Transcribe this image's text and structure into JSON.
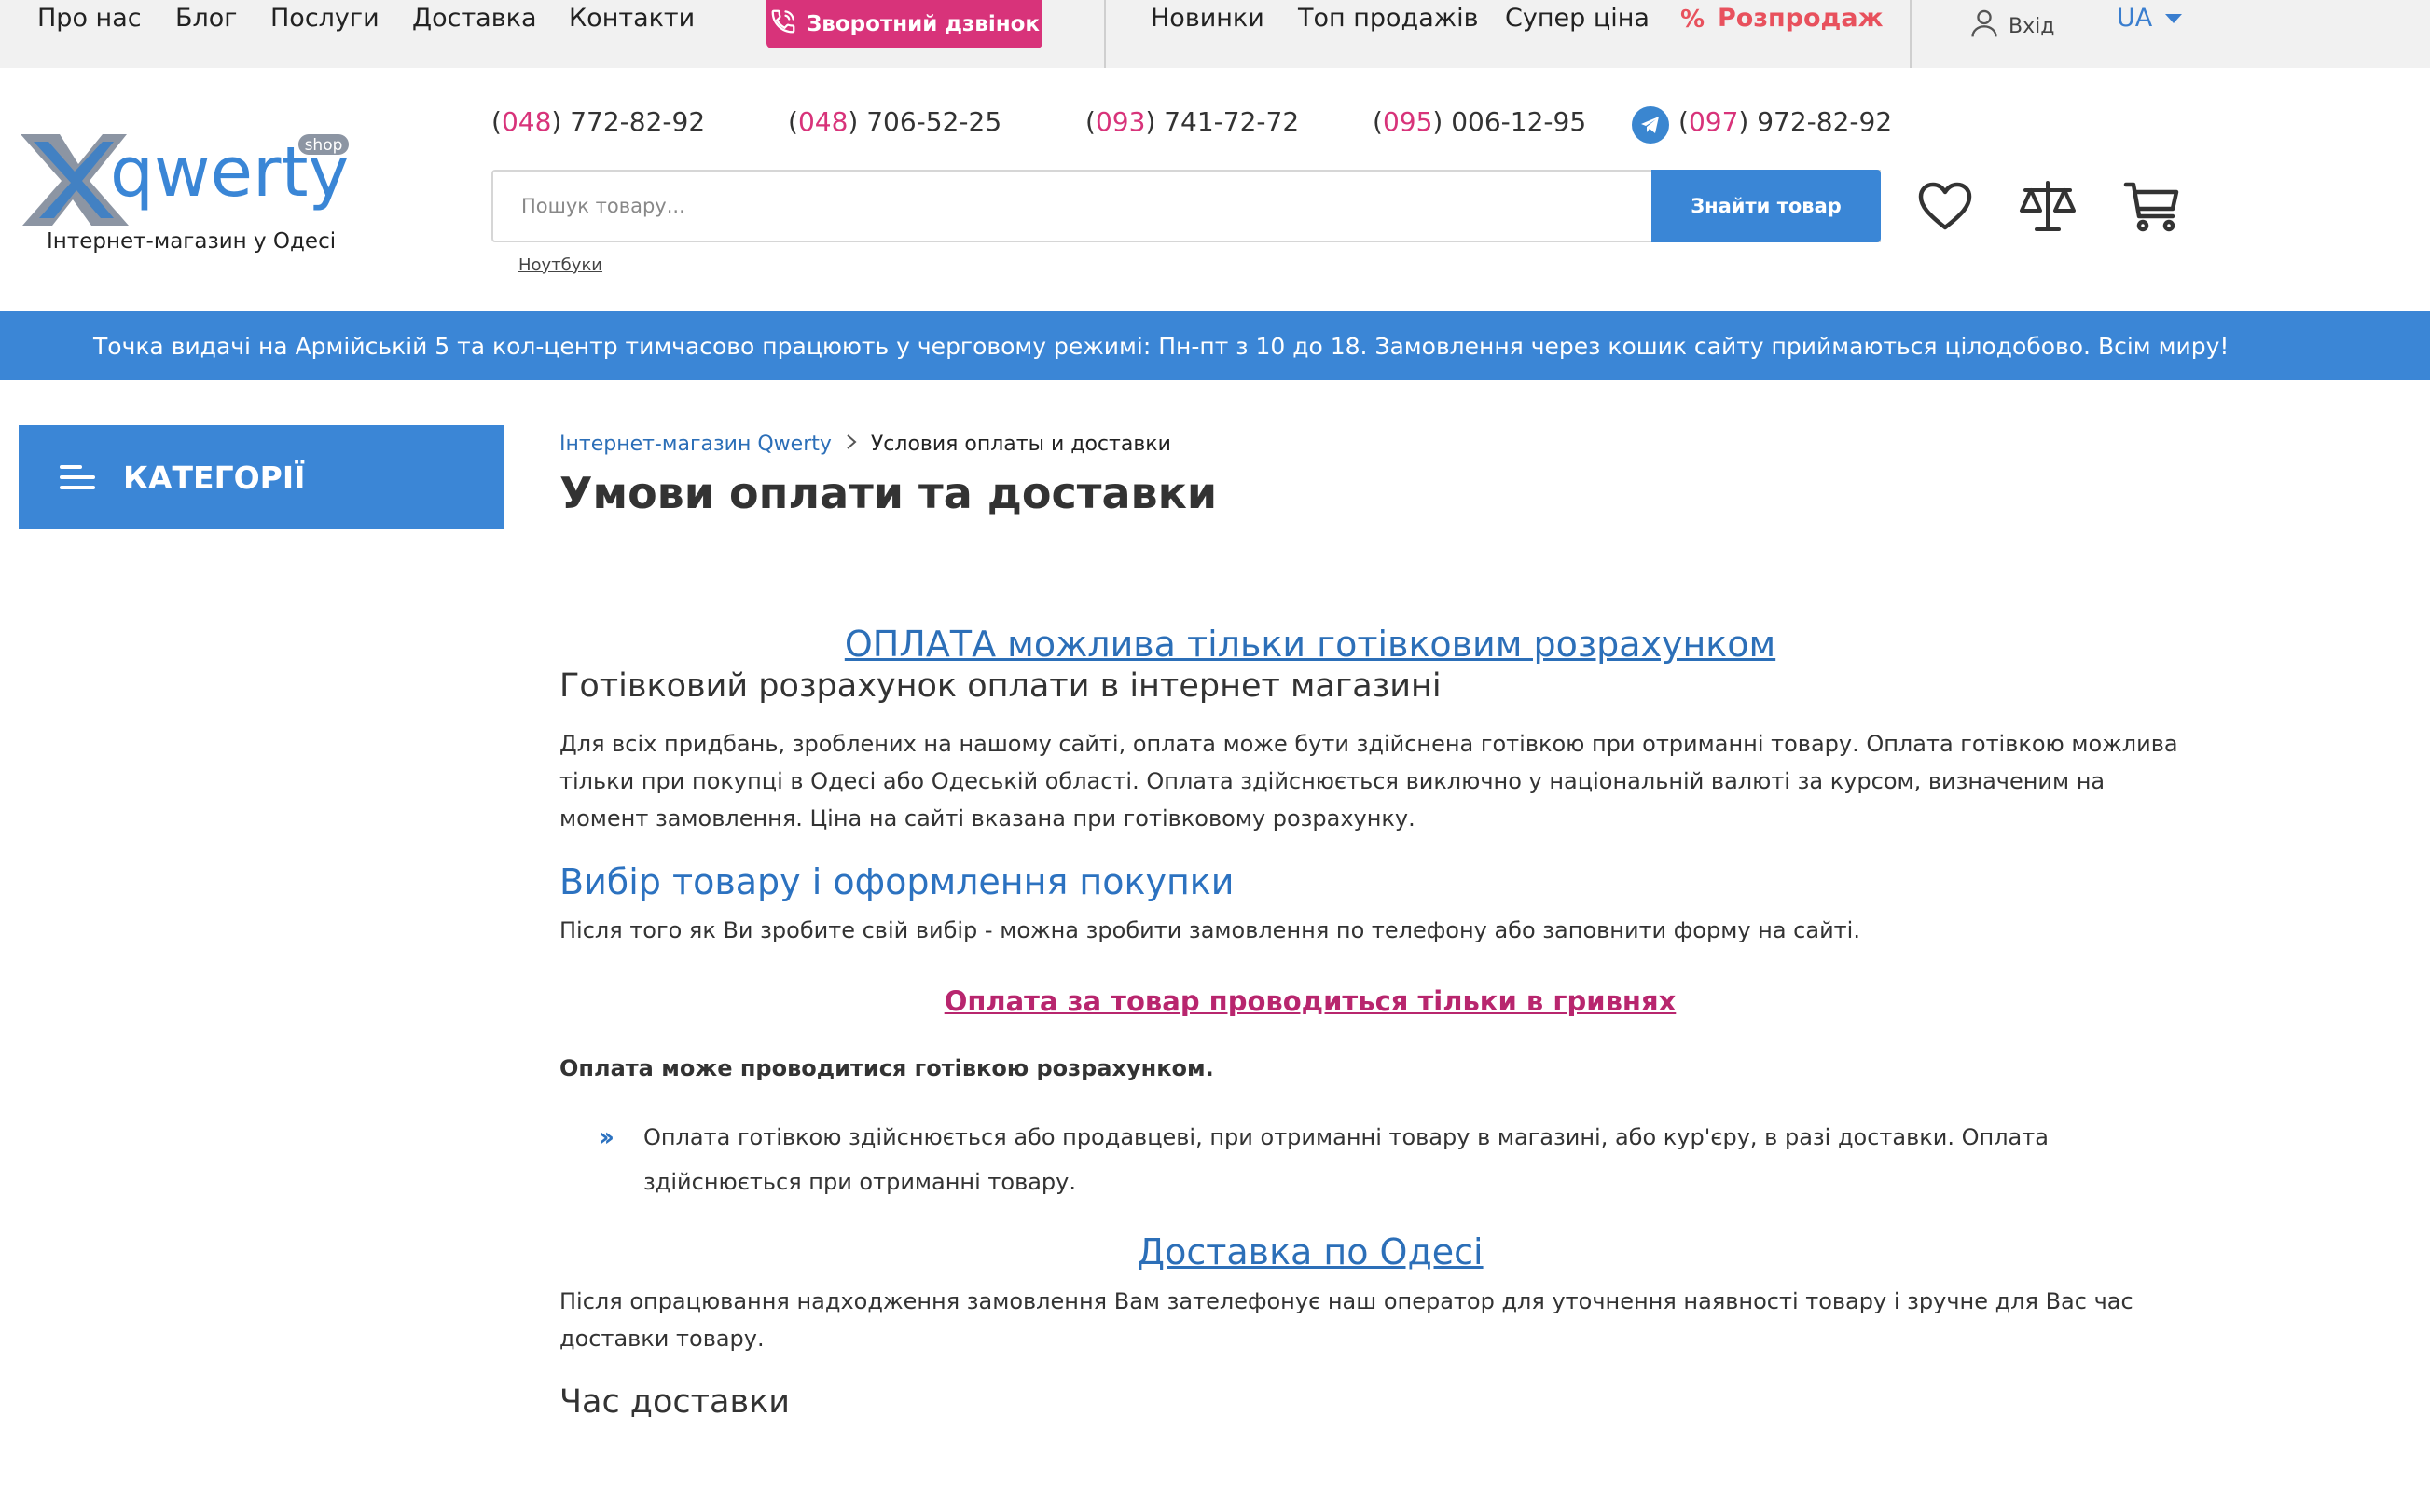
{
  "topbar": {
    "links_left": [
      "Про нас",
      "Блог",
      "Послуги",
      "Доставка",
      "Контакти"
    ],
    "callback_label": "Зворотний дзвінок",
    "links_right": [
      "Новинки",
      "Топ продажів",
      "Супер ціна"
    ],
    "sale_label": "Розпродаж",
    "login_label": "Вхід",
    "lang_label": "UA"
  },
  "header": {
    "logo_text": "qwerty",
    "logo_badge": "shop",
    "logo_tagline": "Інтернет-магазин у Одесі",
    "phones": [
      {
        "code": "048",
        "number": "772-82-92"
      },
      {
        "code": "048",
        "number": "706-52-25"
      },
      {
        "code": "093",
        "number": "741-72-72"
      },
      {
        "code": "095",
        "number": "006-12-95"
      },
      {
        "code": "097",
        "number": "972-82-92"
      }
    ],
    "search_placeholder": "Пошук товару...",
    "search_button": "Знайти товар",
    "search_hint": "Ноутбуки",
    "icons": [
      "heart-icon",
      "scales-icon",
      "cart-icon"
    ]
  },
  "banner": {
    "text": "Точка видачі на Армійській 5 та кол-центр тимчасово працюють у черговому режимі: Пн-пт з 10 до 18. Замовлення через кошик сайту приймаються цілодобово. Всім миру!"
  },
  "sidebar": {
    "categories_label": "КАТЕГОРІЇ"
  },
  "breadcrumb": {
    "home": "Інтернет-магазин Qwerty",
    "current": "Условия оплаты и доставки"
  },
  "page": {
    "title": "Умови оплати та доставки"
  },
  "content": {
    "h_payment": "ОПЛАТА можлива тільки готівковим розрахунком",
    "h_cash": "Готівковий розрахунок оплати в інтернет магазині",
    "p_cash": "Для всіх придбань, зроблених на нашому сайті, оплата може бути здійснена готівкою при отриманні товару. Оплата готівкою можлива тільки при покупці в Одесі або Одеській області. Оплата здійснюється виключно у національній валюті за курсом, визначеним на момент замовлення. Ціна на сайті вказана при готівковому розрахунку.",
    "h_choice": "Вибір товару і оформлення покупки",
    "p_choice": "Після того як Ви зробите свій вибір - можна зробити замовлення по телефону або заповнити форму на сайті.",
    "h_uah": "Оплата за товар проводиться тільки в гривнях",
    "bold_cash": "Оплата може проводитися готівкою розрахунком.",
    "bullet_1": "Оплата готівкою здійснюється або продавцеві, при отриманні товару в магазині, або кур'єру, в разі доставки. Оплата здійснюється при отриманні товару.",
    "h_delivery": "Доставка по Одесі",
    "p_delivery": "Після опрацювання надходження замовлення Вам зателефонує наш оператор для уточнення наявності товару і зручне для Вас час доставки товару.",
    "h_time": "Час доставки"
  },
  "colors": {
    "accent_blue": "#3b86d6",
    "link_blue": "#2c6fb8",
    "pink": "#d8337a",
    "sale_red": "#e8515d"
  }
}
